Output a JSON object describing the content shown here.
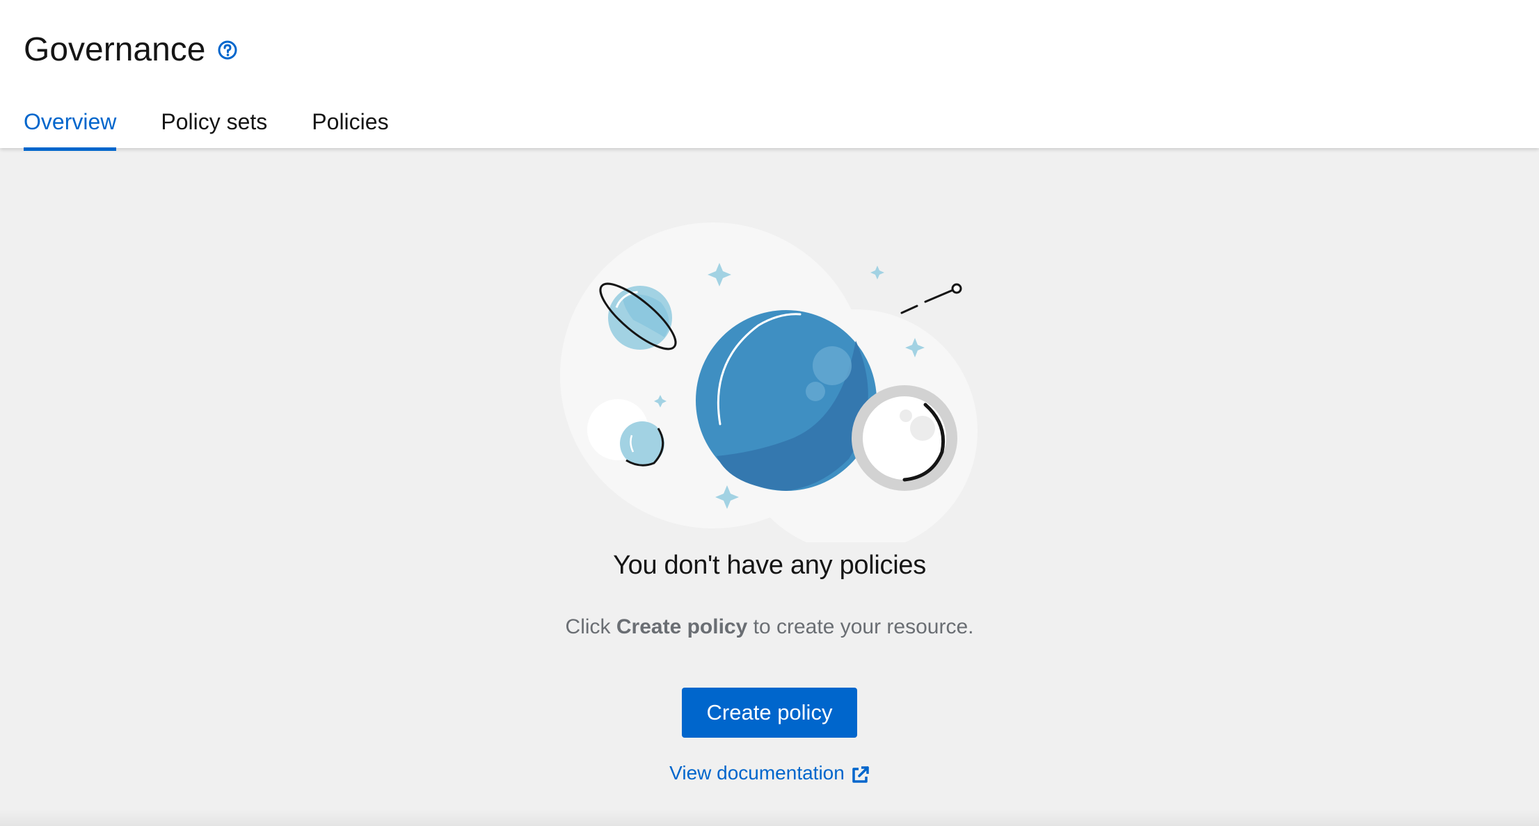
{
  "header": {
    "title": "Governance",
    "help_icon": "question-circle-icon"
  },
  "tabs": [
    {
      "label": "Overview",
      "active": true
    },
    {
      "label": "Policy sets",
      "active": false
    },
    {
      "label": "Policies",
      "active": false
    }
  ],
  "empty_state": {
    "illustration": "planets-space-illustration",
    "title": "You don't have any policies",
    "body_prefix": "Click",
    "body_bold": "Create policy",
    "body_suffix": "to create your resource.",
    "primary_button": "Create policy",
    "doc_link": "View documentation",
    "doc_link_icon": "external-link-icon"
  },
  "colors": {
    "accent": "#0066cc",
    "page_bg": "#f0f0f0",
    "header_bg": "#ffffff",
    "planet_blue": "#4393c3",
    "planet_light": "#a2d2e3"
  }
}
